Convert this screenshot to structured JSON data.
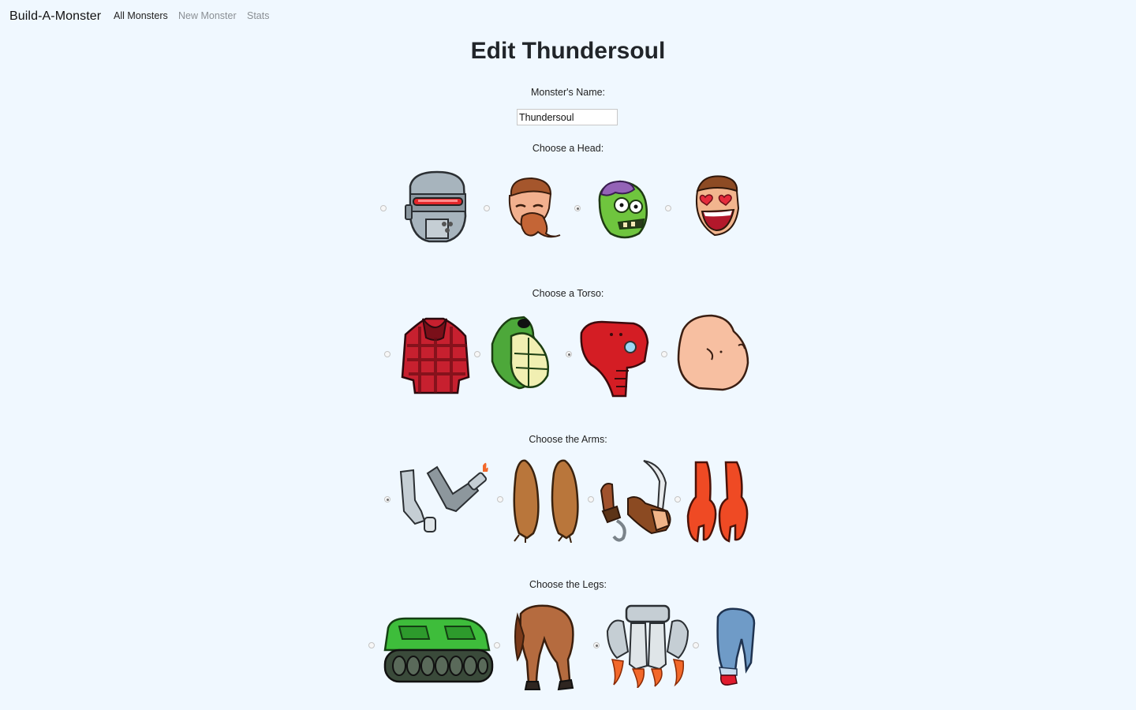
{
  "nav": {
    "brand": "Build-A-Monster",
    "links": [
      "All Monsters",
      "New Monster",
      "Stats"
    ]
  },
  "page": {
    "title": "Edit Thundersoul"
  },
  "form": {
    "name_label": "Monster's Name:",
    "name_value": "Thundersoul",
    "head_label": "Choose a Head:",
    "torso_label": "Choose a Torso:",
    "arms_label": "Choose the Arms:",
    "legs_label": "Choose the Legs:",
    "heads": [
      {
        "icon": "robot-head-icon",
        "selected": false
      },
      {
        "icon": "bearded-man-head-icon",
        "selected": false
      },
      {
        "icon": "zombie-head-icon",
        "selected": true
      },
      {
        "icon": "lovestruck-head-icon",
        "selected": false
      }
    ],
    "torsos": [
      {
        "icon": "plaid-shirt-torso-icon",
        "selected": false
      },
      {
        "icon": "turtle-shell-torso-icon",
        "selected": false
      },
      {
        "icon": "red-armor-torso-icon",
        "selected": true
      },
      {
        "icon": "bald-flesh-torso-icon",
        "selected": false
      }
    ],
    "arms": [
      {
        "icon": "robot-arms-icon",
        "selected": true
      },
      {
        "icon": "furry-arms-icon",
        "selected": false
      },
      {
        "icon": "pirate-arms-icon",
        "selected": false
      },
      {
        "icon": "lobster-claw-arms-icon",
        "selected": false
      }
    ],
    "legs": [
      {
        "icon": "tank-treads-legs-icon",
        "selected": false
      },
      {
        "icon": "horse-legs-icon",
        "selected": false
      },
      {
        "icon": "rocket-legs-icon",
        "selected": true
      },
      {
        "icon": "jeans-heels-legs-icon",
        "selected": false
      }
    ]
  },
  "colors": {
    "background": "#f0f8ff",
    "text": "#212529",
    "muted_link": "#8a8f94"
  }
}
